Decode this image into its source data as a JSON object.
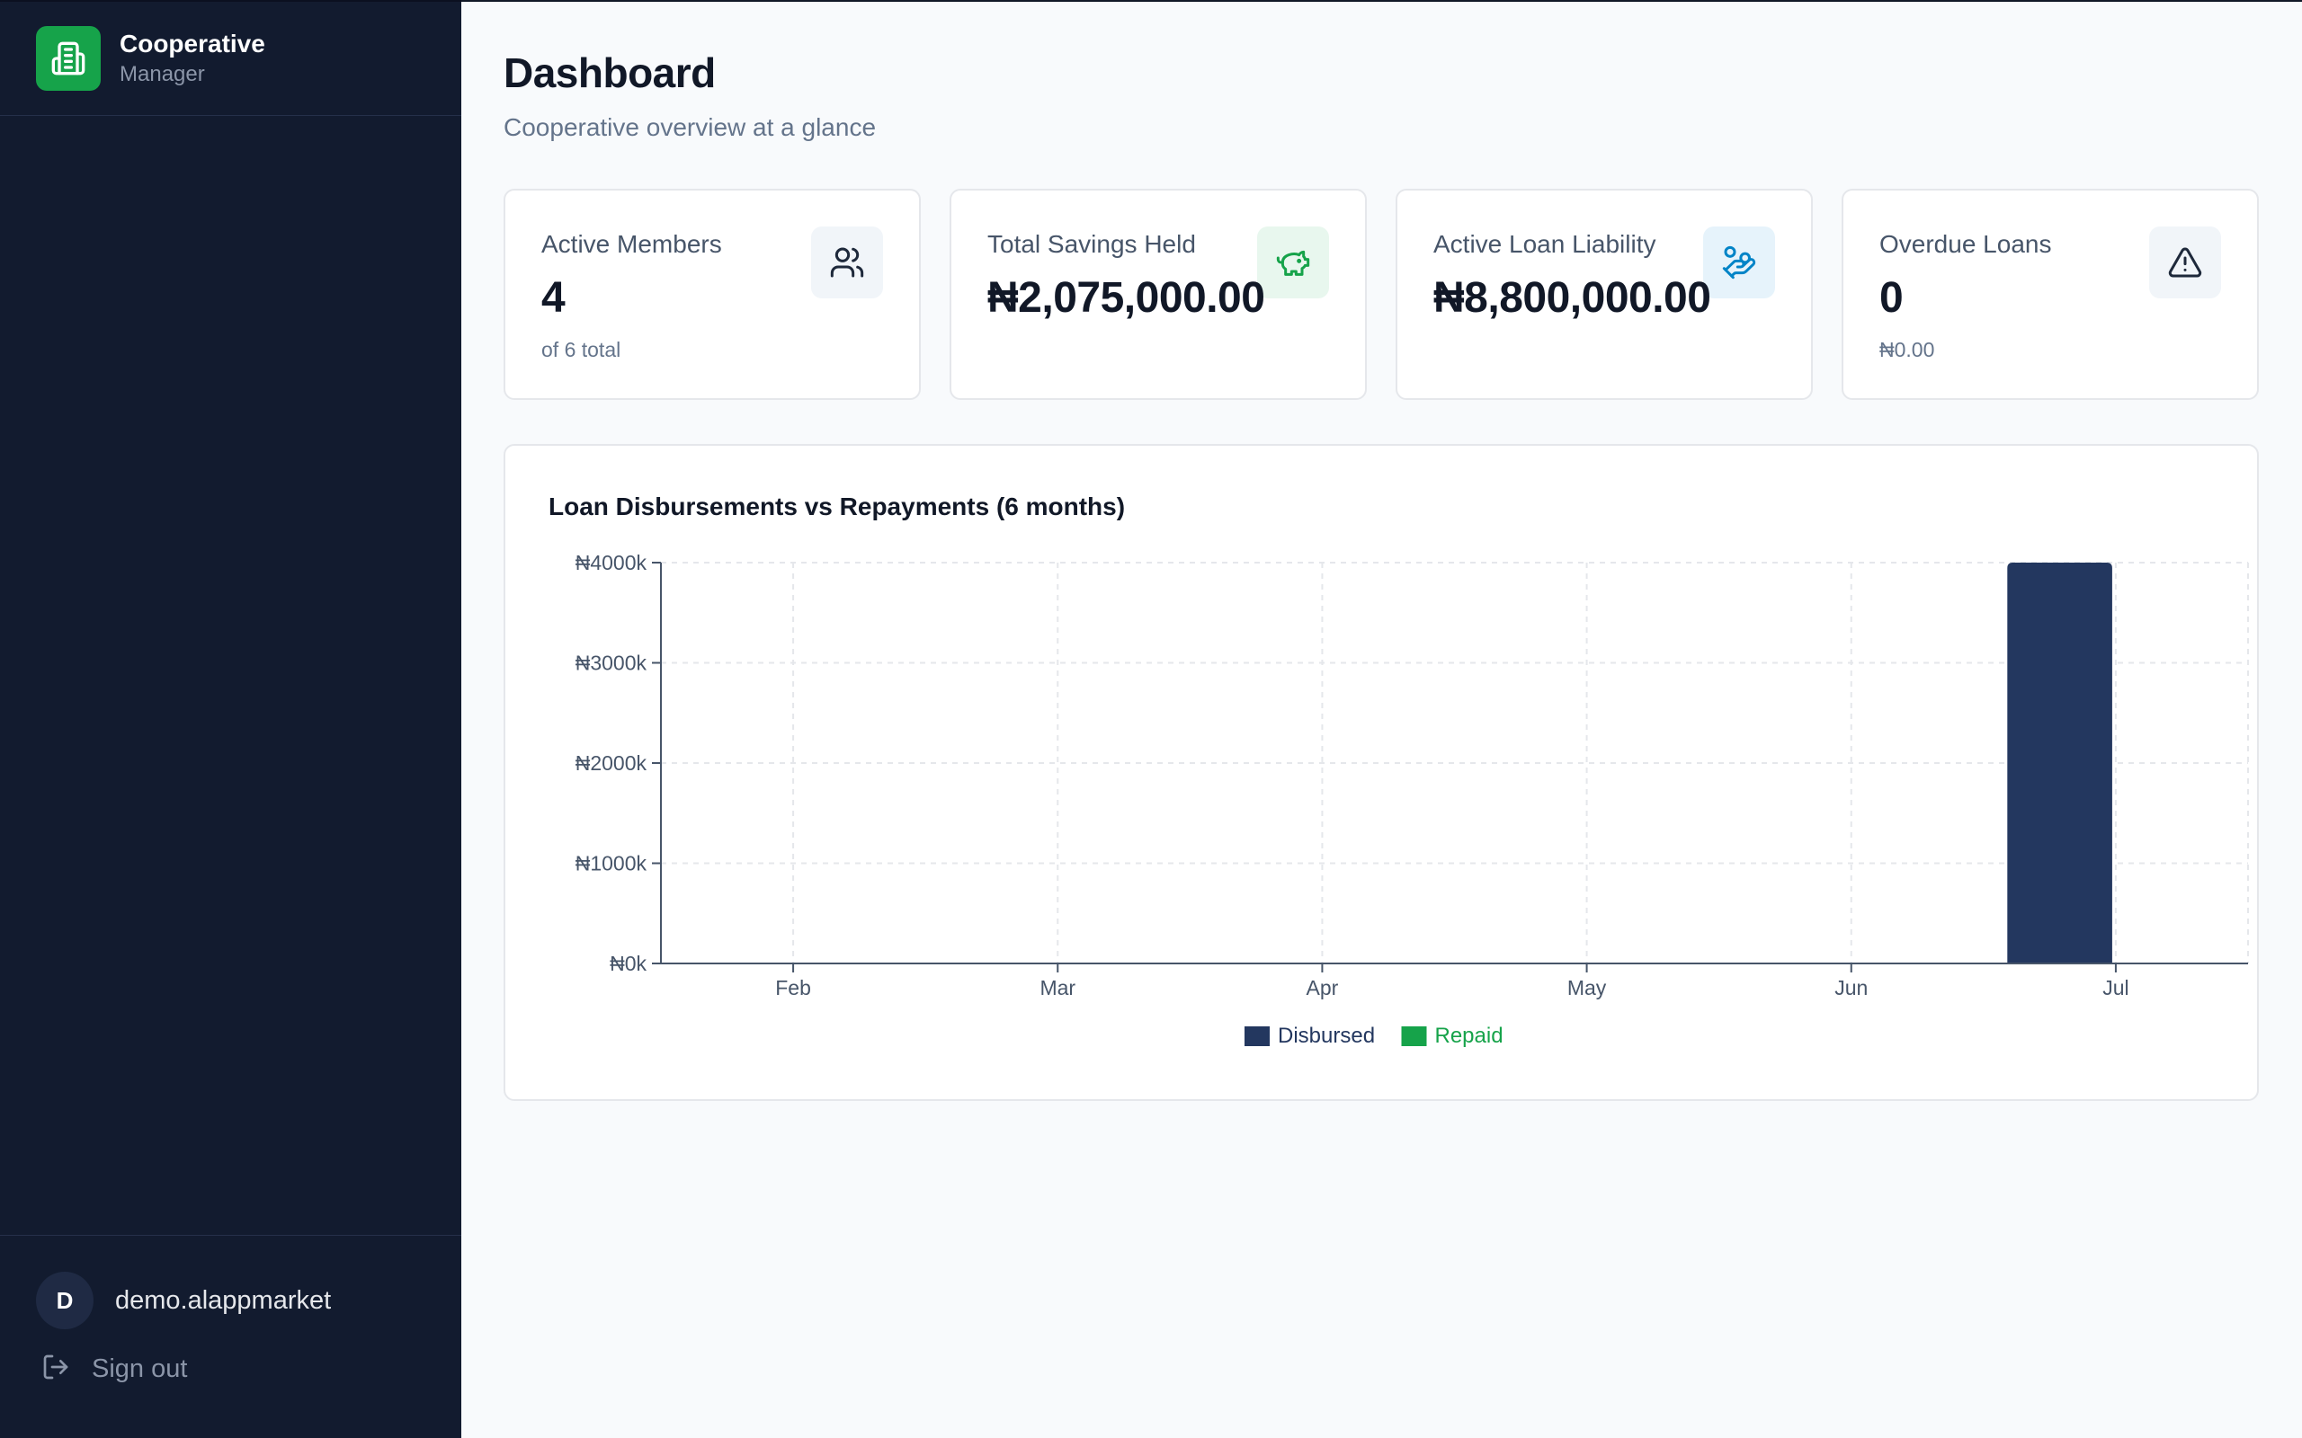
{
  "sidebar": {
    "brand_title": "Cooperative",
    "brand_subtitle": "Manager",
    "user": {
      "initial": "D",
      "name": "demo.alappmarket"
    },
    "signout_label": "Sign out"
  },
  "header": {
    "title": "Dashboard",
    "subtitle": "Cooperative overview at a glance"
  },
  "stats": [
    {
      "title": "Active Members",
      "value": "4",
      "sub": "of 6 total",
      "icon": "users-icon",
      "icon_bg": "#f1f5f9",
      "icon_color": "#1e293b"
    },
    {
      "title": "Total Savings Held",
      "value": "₦2,075,000.00",
      "sub": "",
      "icon": "piggy-bank-icon",
      "icon_bg": "#e8f7ee",
      "icon_color": "#16a34a"
    },
    {
      "title": "Active Loan Liability",
      "value": "₦8,800,000.00",
      "sub": "",
      "icon": "hand-coins-icon",
      "icon_bg": "#e6f3fb",
      "icon_color": "#0284c7"
    },
    {
      "title": "Overdue Loans",
      "value": "0",
      "sub": "₦0.00",
      "icon": "alert-triangle-icon",
      "icon_bg": "#f1f5f9",
      "icon_color": "#1e293b"
    }
  ],
  "colors": {
    "disbursed": "#23375f",
    "repaid": "#16a34a"
  },
  "chart_data": {
    "type": "bar",
    "title": "Loan Disbursements vs Repayments (6 months)",
    "categories": [
      "Feb",
      "Mar",
      "Apr",
      "May",
      "Jun",
      "Jul"
    ],
    "series": [
      {
        "name": "Disbursed",
        "values": [
          0,
          0,
          0,
          0,
          0,
          4000
        ]
      },
      {
        "name": "Repaid",
        "values": [
          0,
          0,
          0,
          0,
          0,
          0
        ]
      }
    ],
    "ylim": [
      0,
      4000
    ],
    "yticks": [
      0,
      1000,
      2000,
      3000,
      4000
    ],
    "ytick_labels": [
      "₦0k",
      "₦1000k",
      "₦2000k",
      "₦3000k",
      "₦4000k"
    ],
    "grid": true,
    "legend": "bottom-center"
  }
}
